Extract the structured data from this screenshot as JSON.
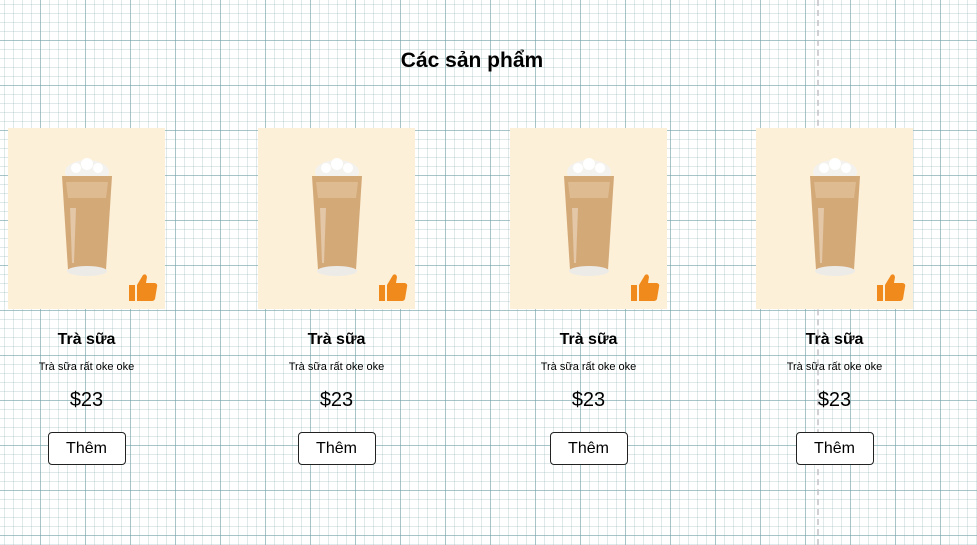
{
  "page": {
    "title": "Các sản phẩm"
  },
  "products": [
    {
      "name": "Trà sữa",
      "description": "Trà sữa rất oke oke",
      "price": "$23",
      "button_label": "Thêm"
    },
    {
      "name": "Trà sữa",
      "description": "Trà sữa rất oke oke",
      "price": "$23",
      "button_label": "Thêm"
    },
    {
      "name": "Trà sữa",
      "description": "Trà sữa rất oke oke",
      "price": "$23",
      "button_label": "Thêm"
    },
    {
      "name": "Trà sữa",
      "description": "Trà sữa rất oke oke",
      "price": "$23",
      "button_label": "Thêm"
    }
  ],
  "icons": {
    "product_image": "iced-milk-tea-icon",
    "badge": "thumbs-up-icon"
  },
  "colors": {
    "image_background": "#fdf0d8",
    "badge": "#f08a1c",
    "drink": "#d4a978"
  }
}
